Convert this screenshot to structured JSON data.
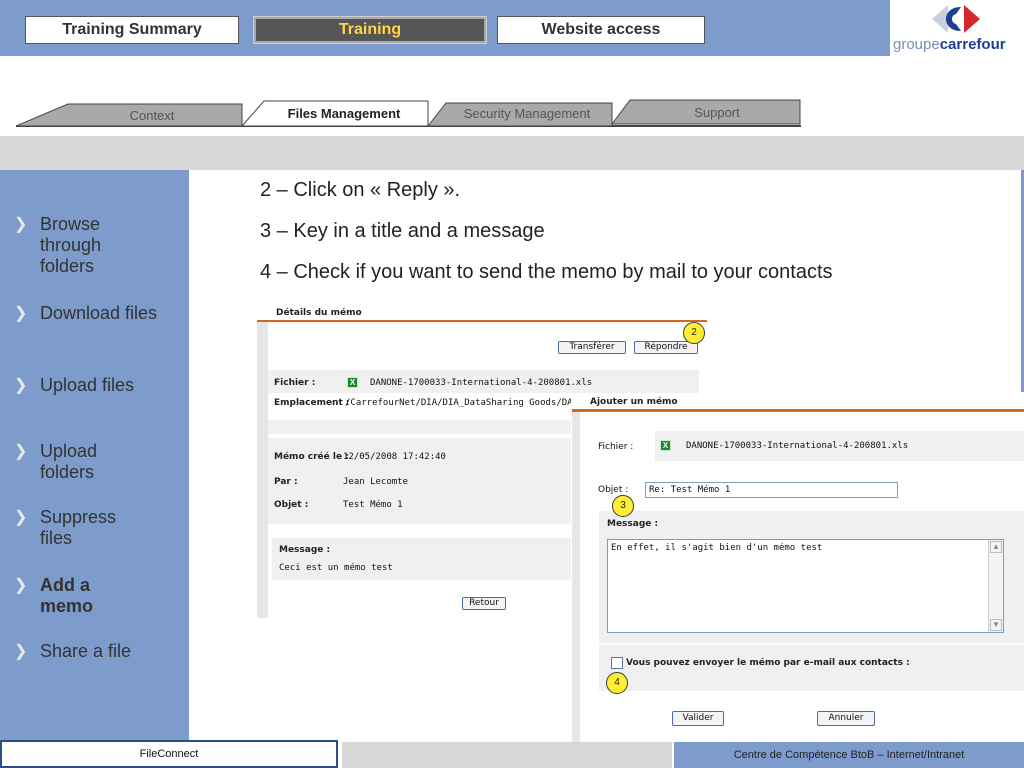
{
  "header": {
    "nav_buttons": [
      "Training Summary",
      "Training",
      "Website access"
    ],
    "logo": {
      "prefix": "groupe",
      "brand": "carrefour"
    }
  },
  "tabs": [
    "Context",
    "Files Management",
    "Security Management",
    "Support"
  ],
  "sidebar": {
    "items": [
      {
        "label": "Browse through folders"
      },
      {
        "label": "Download files"
      },
      {
        "label": "Upload files"
      },
      {
        "label": "Upload folders"
      },
      {
        "label": "Suppress files"
      },
      {
        "label": "Add a memo"
      },
      {
        "label": "Share a file"
      }
    ]
  },
  "instructions": [
    "2 – Click on « Reply ».",
    "3 – Key in a title and a message",
    "4 – Check if you want to send the memo by mail to your contacts"
  ],
  "memo_details": {
    "title": "Détails du mémo",
    "btn_transfer": "Transférer",
    "btn_reply": "Répondre",
    "file_label": "Fichier :",
    "file_name": "DANONE-1700033-International-4-200801.xls",
    "location_label": "Emplacement :",
    "location": "/CarrefourNet/DIA/DIA_DataSharing Goods/DANON",
    "created_label": "Mémo créé le :",
    "created": "12/05/2008 17:42:40",
    "by_label": "Par :",
    "by": "Jean Lecomte",
    "subject_label": "Objet :",
    "subject": "Test Mémo 1",
    "message_label": "Message :",
    "message": "Ceci est un mémo test",
    "btn_back": "Retour"
  },
  "add_memo": {
    "title": "Ajouter un mémo",
    "file_label": "Fichier :",
    "file_name": "DANONE-1700033-International-4-200801.xls",
    "subject_label": "Objet :",
    "subject_value": "Re: Test Mémo 1",
    "message_label": "Message :",
    "message_value": "En effet, il s'agit bien d'un mémo test",
    "checkbox_label": "Vous pouvez envoyer le mémo par e-mail aux contacts :",
    "btn_validate": "Valider",
    "btn_cancel": "Annuler"
  },
  "callouts": [
    "2",
    "3",
    "4"
  ],
  "icons": {
    "file": "excel-file-icon",
    "nav": "chevron-right-icon"
  },
  "footer": {
    "left": "FileConnect",
    "right": "Centre de Compétence BtoB – Internet/Intranet"
  },
  "colors": {
    "brand_blue": "#7d9ccb",
    "accent_orange": "#d2691e",
    "callout_yellow": "#ffee33"
  }
}
